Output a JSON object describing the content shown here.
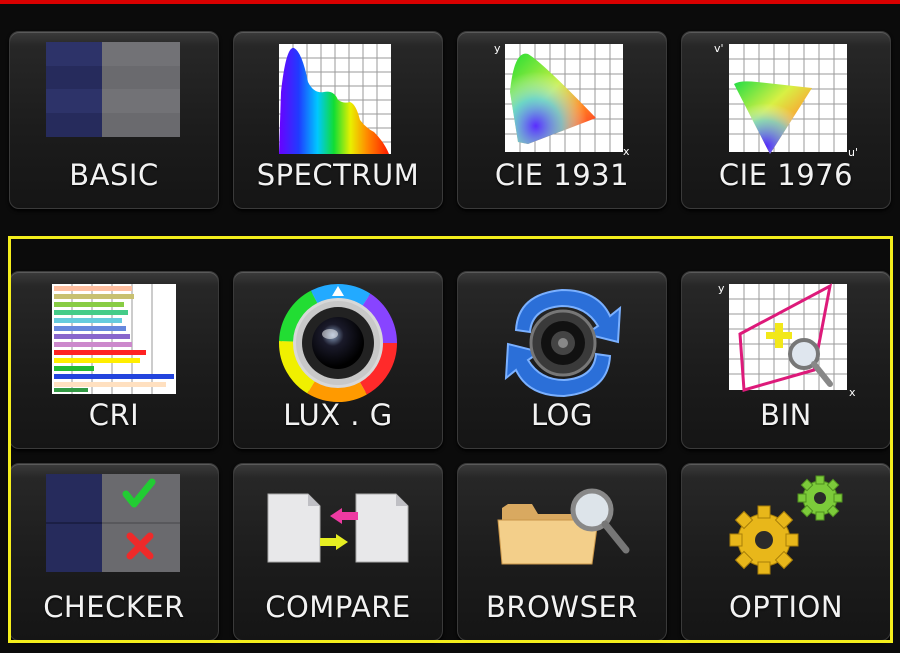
{
  "menu": {
    "tiles": [
      {
        "label": "BASIC"
      },
      {
        "label": "SPECTRUM"
      },
      {
        "label": "CIE 1931"
      },
      {
        "label": "CIE 1976"
      },
      {
        "label": "CRI"
      },
      {
        "label": "LUX . G"
      },
      {
        "label": "LOG"
      },
      {
        "label": "BIN"
      },
      {
        "label": "CHECKER"
      },
      {
        "label": "COMPARE"
      },
      {
        "label": "BROWSER"
      },
      {
        "label": "OPTION"
      }
    ]
  },
  "icons": {
    "cie1931_axis_y": "y",
    "cie1931_axis_x": "x",
    "cie1976_axis_v": "v'",
    "cie1976_axis_u": "u'",
    "bin_axis_y": "y",
    "bin_axis_x": "x"
  },
  "colors": {
    "top_bar": "#d90000",
    "highlight_frame": "#f4ee1c"
  }
}
